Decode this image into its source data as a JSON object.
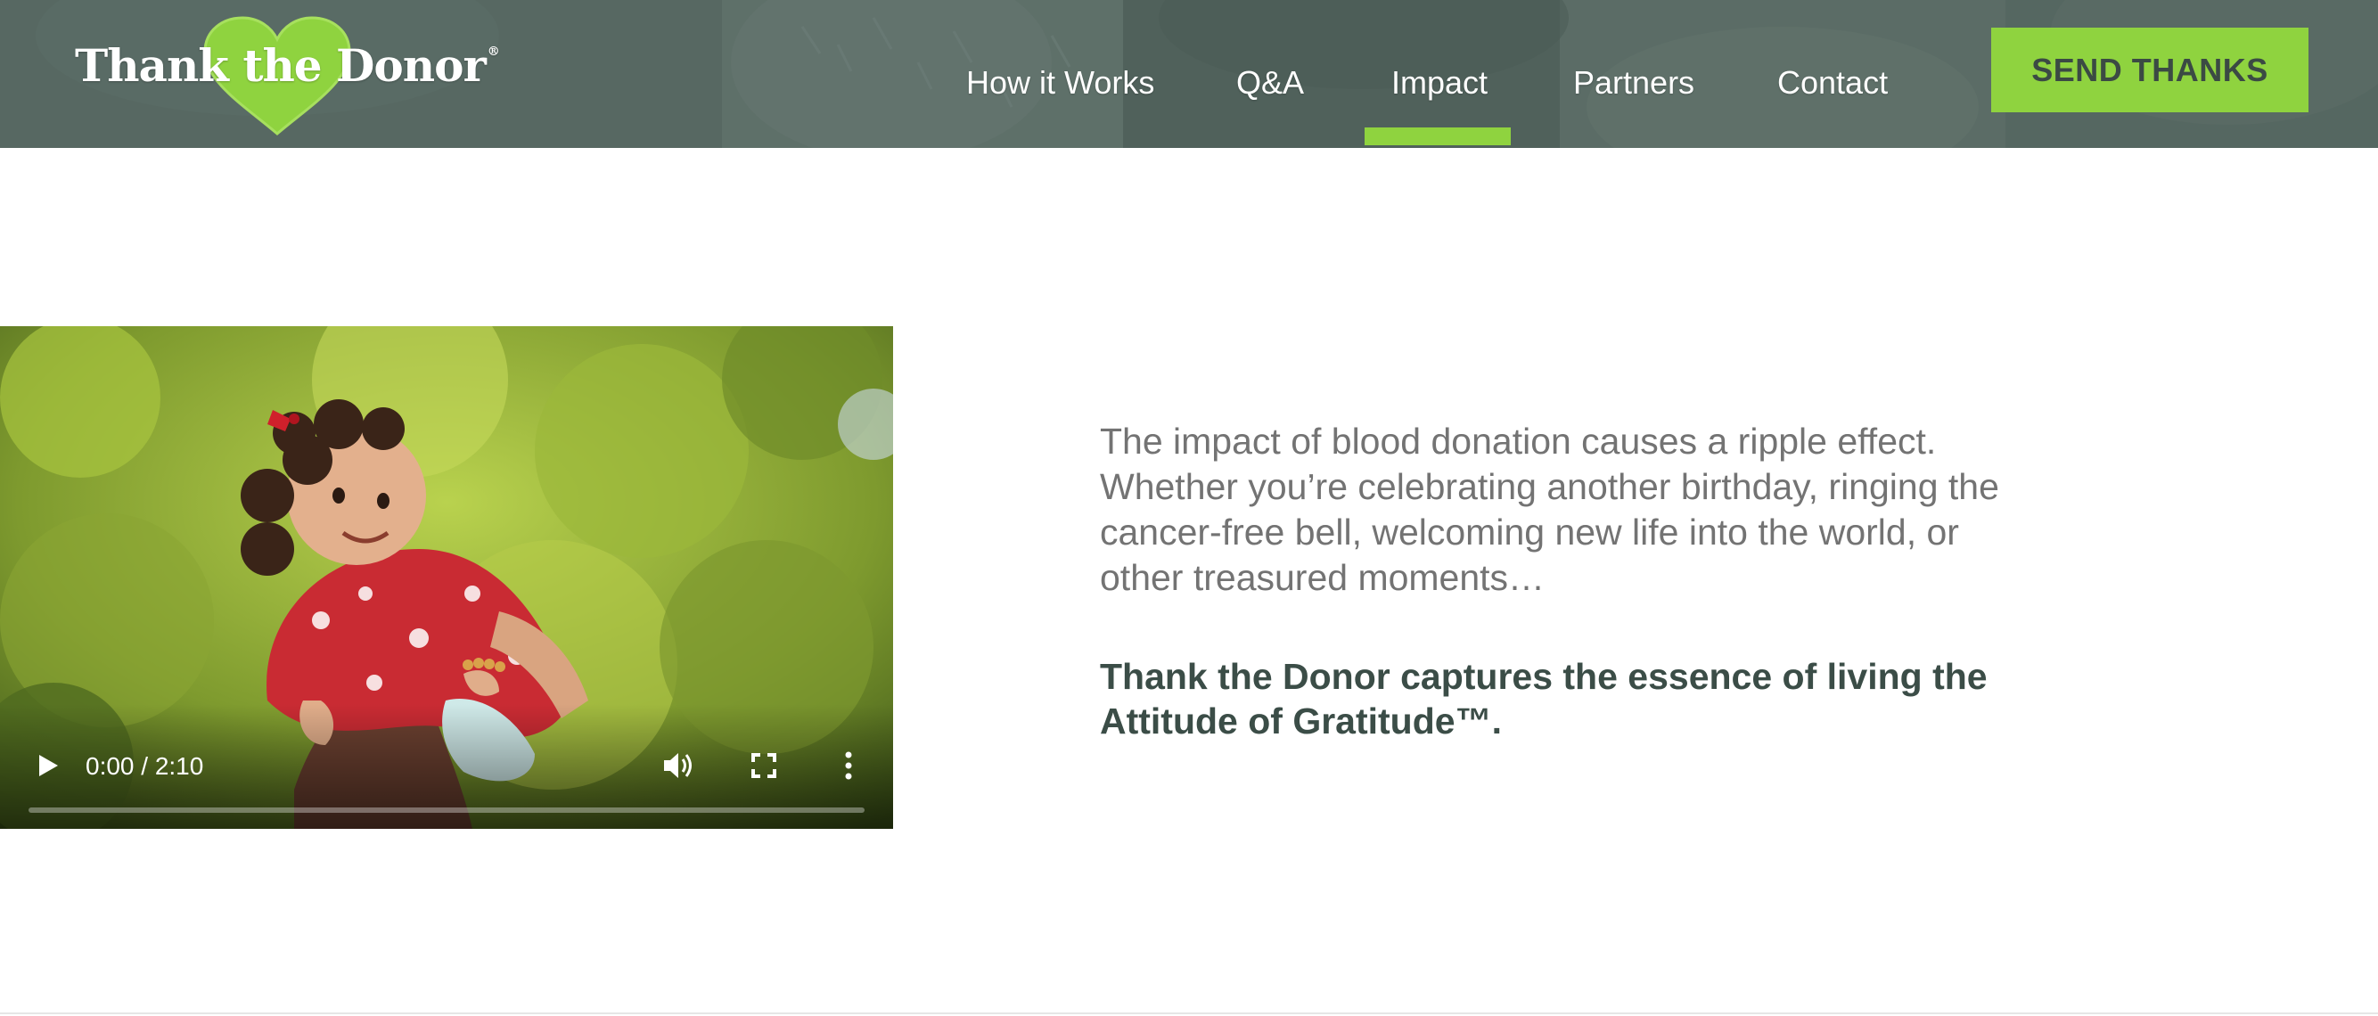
{
  "brand": {
    "logo_text": "Thank the Donor",
    "logo_mark": "®",
    "accent_color": "#8fd33f",
    "header_color": "#5d6f69"
  },
  "nav": {
    "items": [
      {
        "label": "How it Works",
        "active": false
      },
      {
        "label": "Q&A",
        "active": false
      },
      {
        "label": "Impact",
        "active": true
      },
      {
        "label": "Partners",
        "active": false
      },
      {
        "label": "Contact",
        "active": false
      }
    ],
    "cta_label": "SEND THANKS"
  },
  "video": {
    "time_display": "0:00 / 2:10",
    "progress_fraction": 0,
    "icons": {
      "play": "play-icon",
      "volume": "volume-icon",
      "fullscreen": "fullscreen-icon",
      "more": "more-options-icon"
    }
  },
  "content": {
    "intro": "The impact of blood donation causes a ripple effect. Whether you’re celebrating another birthday, ringing the cancer-free bell, welcoming new life into the world, or other treasured moments…",
    "tagline": "Thank the Donor captures the essence of living the Attitude of Gratitude™."
  }
}
